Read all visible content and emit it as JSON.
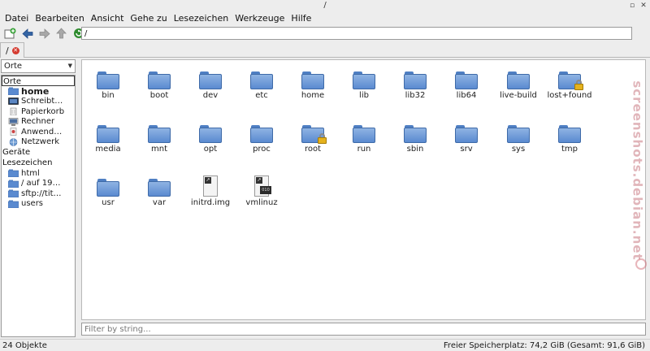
{
  "window": {
    "title": "/"
  },
  "menu": [
    {
      "label": "Datei"
    },
    {
      "label": "Bearbeiten"
    },
    {
      "label": "Ansicht"
    },
    {
      "label": "Gehe zu"
    },
    {
      "label": "Lesezeichen"
    },
    {
      "label": "Werkzeuge"
    },
    {
      "label": "Hilfe"
    }
  ],
  "toolbar": {
    "path": "/"
  },
  "tab": {
    "label": "/"
  },
  "sidebar": {
    "selector": "Orte",
    "places_header": "Orte",
    "places": [
      {
        "label": "home",
        "icon": "home-folder-icon"
      },
      {
        "label": "Schreibt…",
        "icon": "desktop-icon"
      },
      {
        "label": "Papierkorb",
        "icon": "trash-icon"
      },
      {
        "label": "Rechner",
        "icon": "computer-icon"
      },
      {
        "label": "Anwend…",
        "icon": "applications-icon"
      },
      {
        "label": "Netzwerk",
        "icon": "network-icon"
      }
    ],
    "devices_header": "Geräte",
    "bookmarks_header": "Lesezeichen",
    "bookmarks": [
      {
        "label": "html"
      },
      {
        "label": "/ auf 19…"
      },
      {
        "label": "sftp://tit…"
      },
      {
        "label": "users"
      }
    ]
  },
  "files": [
    {
      "name": "bin",
      "type": "folder"
    },
    {
      "name": "boot",
      "type": "folder"
    },
    {
      "name": "dev",
      "type": "folder"
    },
    {
      "name": "etc",
      "type": "folder"
    },
    {
      "name": "home",
      "type": "folder"
    },
    {
      "name": "lib",
      "type": "folder"
    },
    {
      "name": "lib32",
      "type": "folder"
    },
    {
      "name": "lib64",
      "type": "folder"
    },
    {
      "name": "live-build",
      "type": "folder"
    },
    {
      "name": "lost+found",
      "type": "folder-locked"
    },
    {
      "name": "media",
      "type": "folder"
    },
    {
      "name": "mnt",
      "type": "folder"
    },
    {
      "name": "opt",
      "type": "folder"
    },
    {
      "name": "proc",
      "type": "folder"
    },
    {
      "name": "root",
      "type": "folder-locked"
    },
    {
      "name": "run",
      "type": "folder"
    },
    {
      "name": "sbin",
      "type": "folder"
    },
    {
      "name": "srv",
      "type": "folder"
    },
    {
      "name": "sys",
      "type": "folder"
    },
    {
      "name": "tmp",
      "type": "folder"
    },
    {
      "name": "usr",
      "type": "folder"
    },
    {
      "name": "var",
      "type": "folder"
    },
    {
      "name": "initrd.img",
      "type": "file-link"
    },
    {
      "name": "vmlinuz",
      "type": "file-binary"
    }
  ],
  "filter": {
    "placeholder": "Filter by string..."
  },
  "status": {
    "count": "24 Objekte",
    "space": "Freier Speicherplatz: 74,2 GiB (Gesamt: 91,6 GiB)"
  },
  "watermark": "screenshots.debian.net",
  "colors": {
    "folder": "#5a8ad0",
    "lock": "#e5b21d",
    "close": "#d43a2f"
  }
}
